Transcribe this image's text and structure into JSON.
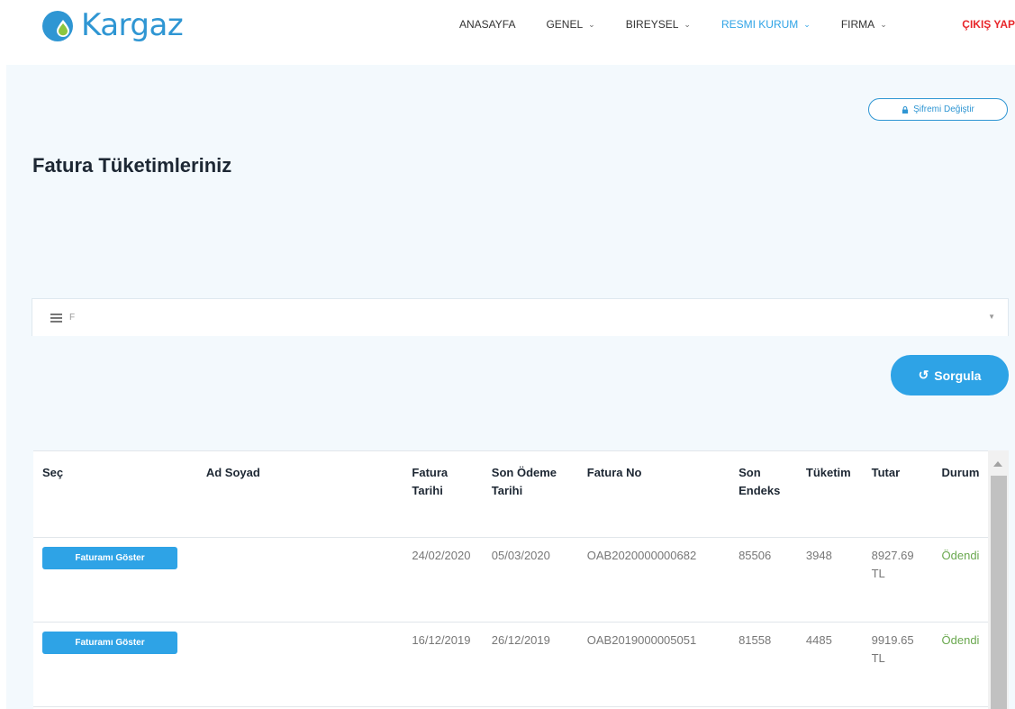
{
  "brand": {
    "name": "Kargaz",
    "colors": {
      "blue": "#2f96d3",
      "green": "#8cc63f",
      "accent": "#2ea3e6",
      "logout": "#e8262a"
    }
  },
  "nav": {
    "items": [
      {
        "label": "ANASAYFA",
        "has_dropdown": false
      },
      {
        "label": "GENEL",
        "has_dropdown": true
      },
      {
        "label": "BIREYSEL",
        "has_dropdown": true
      },
      {
        "label": "RESMI KURUM",
        "has_dropdown": true,
        "active": true
      },
      {
        "label": "FIRMA",
        "has_dropdown": true
      }
    ],
    "logout": "ÇIKIŞ YAP"
  },
  "account": {
    "change_password": "Şifremi Değiştir"
  },
  "page": {
    "title": "Fatura Tüketimleriniz"
  },
  "filter": {
    "value": "F",
    "icon": "list-icon"
  },
  "query": {
    "label": "Sorgula",
    "icon": "refresh-icon"
  },
  "table": {
    "headers": [
      "Seç",
      "Ad Soyad",
      "Fatura Tarihi",
      "Son Ödeme Tarihi",
      "Fatura No",
      "Son Endeks",
      "Tüketim",
      "Tutar",
      "Durum"
    ],
    "button_label": "Faturamı Göster",
    "rows": [
      {
        "name": "",
        "invoice_date": "24/02/2020",
        "due_date": "05/03/2020",
        "invoice_no": "OAB2020000000682",
        "last_index": "85506",
        "consumption": "3948",
        "amount": "8927.69 TL",
        "status": "Ödendi"
      },
      {
        "name": "",
        "invoice_date": "16/12/2019",
        "due_date": "26/12/2019",
        "invoice_no": "OAB2019000005051",
        "last_index": "81558",
        "consumption": "4485",
        "amount": "9919.65 TL",
        "status": "Ödendi"
      }
    ]
  }
}
